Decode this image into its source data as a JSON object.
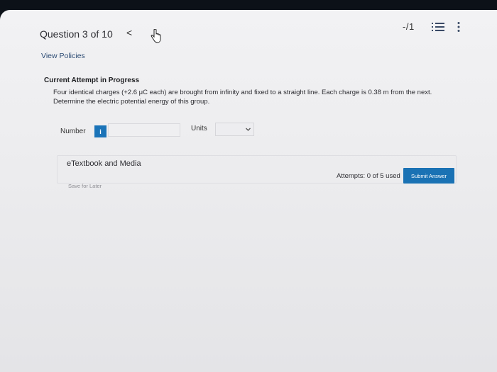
{
  "header": {
    "question_label": "Question 3 of 10",
    "prev_label": "<",
    "score": "-/1",
    "icons": [
      "cursor-hand-icon",
      "list-icon",
      "kebab-menu-icon"
    ]
  },
  "policies_link": "View Policies",
  "attempt": {
    "heading": "Current Attempt in Progress",
    "question_text": "Four identical charges (+2.6 μC each) are brought from infinity and fixed to a straight line. Each charge is 0.38 m from the next. Determine the electric potential energy of this group."
  },
  "answer": {
    "number_label": "Number",
    "info_label": "i",
    "number_value": "",
    "units_label": "Units",
    "units_value": ""
  },
  "footer": {
    "etextbook_label": "eTextbook and Media",
    "save_later_label": "Save for Later",
    "attempts_text": "Attempts: 0 of 5 used",
    "submit_label": "Submit Answer"
  },
  "colors": {
    "accent": "#1a72b4",
    "link": "#2b4a73"
  }
}
